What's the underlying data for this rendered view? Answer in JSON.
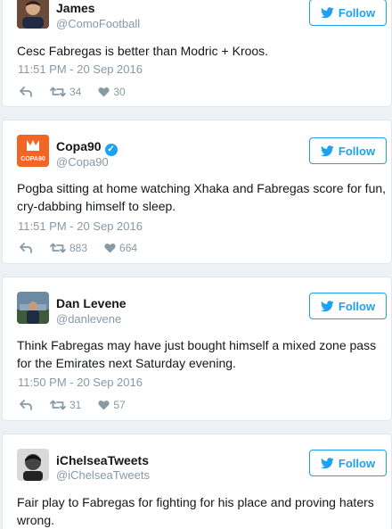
{
  "tweets": [
    {
      "name": "James",
      "handle": "@ComoFootball",
      "follow_label": "Follow",
      "text": "Cesc Fabregas is better than Modric + Kroos.",
      "timestamp": "11:51 PM - 20 Sep 2016",
      "retweets": "34",
      "likes": "30"
    },
    {
      "name": "Copa90",
      "handle": "@Copa90",
      "verified": true,
      "avatar_text": "COPA90",
      "avatar_color": "#f26524",
      "follow_label": "Follow",
      "text": "Pogba sitting at home watching Xhaka and Fabregas score for fun, cry-dabbing himself to sleep.",
      "timestamp": "11:51 PM - 20 Sep 2016",
      "retweets": "883",
      "likes": "664"
    },
    {
      "name": "Dan Levene",
      "handle": "@danlevene",
      "follow_label": "Follow",
      "text": "Think Fabregas may have just bought himself a mixed zone pass for the Emirates next Saturday evening.",
      "timestamp": "11:50 PM - 20 Sep 2016",
      "retweets": "31",
      "likes": "57"
    },
    {
      "name": "iChelseaTweets",
      "handle": "@iChelseaTweets",
      "follow_label": "Follow",
      "text": "Fair play to Fabregas for fighting for his place and proving haters wrong."
    }
  ],
  "colors": {
    "twitter_blue": "#1da1f2",
    "muted": "#8899a6",
    "border": "#e1e8ed",
    "background": "#eef1f4"
  },
  "icons": [
    "twitter-bird-icon",
    "reply-icon",
    "retweet-icon",
    "heart-icon",
    "verified-badge-icon"
  ]
}
